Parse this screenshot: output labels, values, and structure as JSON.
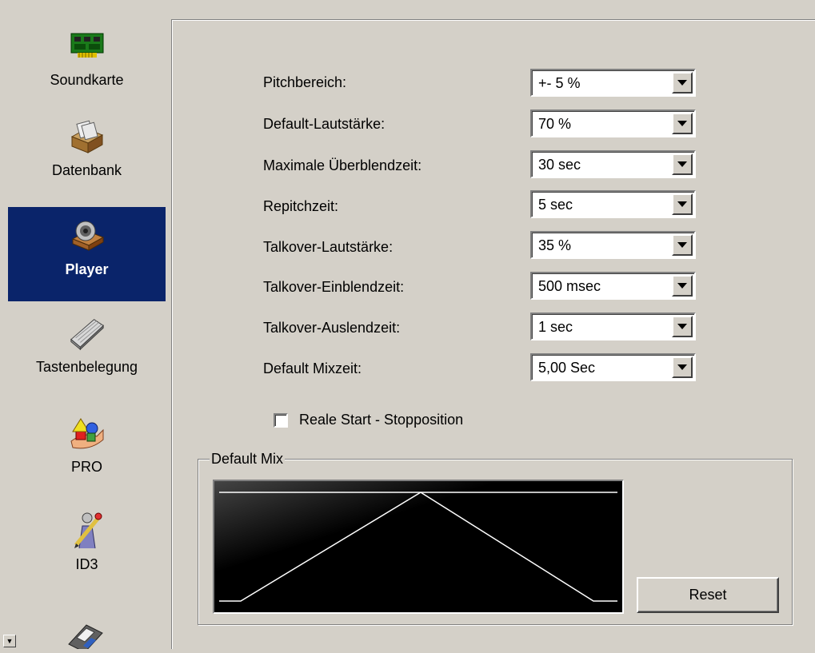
{
  "sidebar": {
    "items": [
      {
        "label": "Soundkarte",
        "icon": "soundcard-icon"
      },
      {
        "label": "Datenbank",
        "icon": "database-box-icon"
      },
      {
        "label": "Player",
        "icon": "player-speaker-icon",
        "active": true
      },
      {
        "label": "Tastenbelegung",
        "icon": "keyboard-icon"
      },
      {
        "label": "PRO",
        "icon": "pro-shapes-icon"
      },
      {
        "label": "ID3",
        "icon": "id3-person-pencil-icon"
      }
    ],
    "partial_item_icon": "floppy-disk-icon"
  },
  "settings": [
    {
      "label": "Pitchbereich:",
      "value": "+- 5 %"
    },
    {
      "label": "Default-Lautstärke:",
      "value": "70 %"
    },
    {
      "label": "Maximale Überblendzeit:",
      "value": "30 sec"
    },
    {
      "label": "Repitchzeit:",
      "value": "5 sec"
    },
    {
      "label": "Talkover-Lautstärke:",
      "value": "35 %"
    },
    {
      "label": "Talkover-Einblendzeit:",
      "value": "500 msec"
    },
    {
      "label": "Talkover-Auslendzeit:",
      "value": "1 sec"
    },
    {
      "label": "Default Mixzeit:",
      "value": "5,00 Sec"
    }
  ],
  "checkbox": {
    "label": "Reale Start - Stopposition",
    "checked": false
  },
  "default_mix": {
    "title": "Default Mix",
    "reset_label": "Reset"
  },
  "colors": {
    "face": "#d4d0c8",
    "selection": "#0a246a",
    "curve": "#ffffff",
    "graph_bg": "#000000"
  }
}
